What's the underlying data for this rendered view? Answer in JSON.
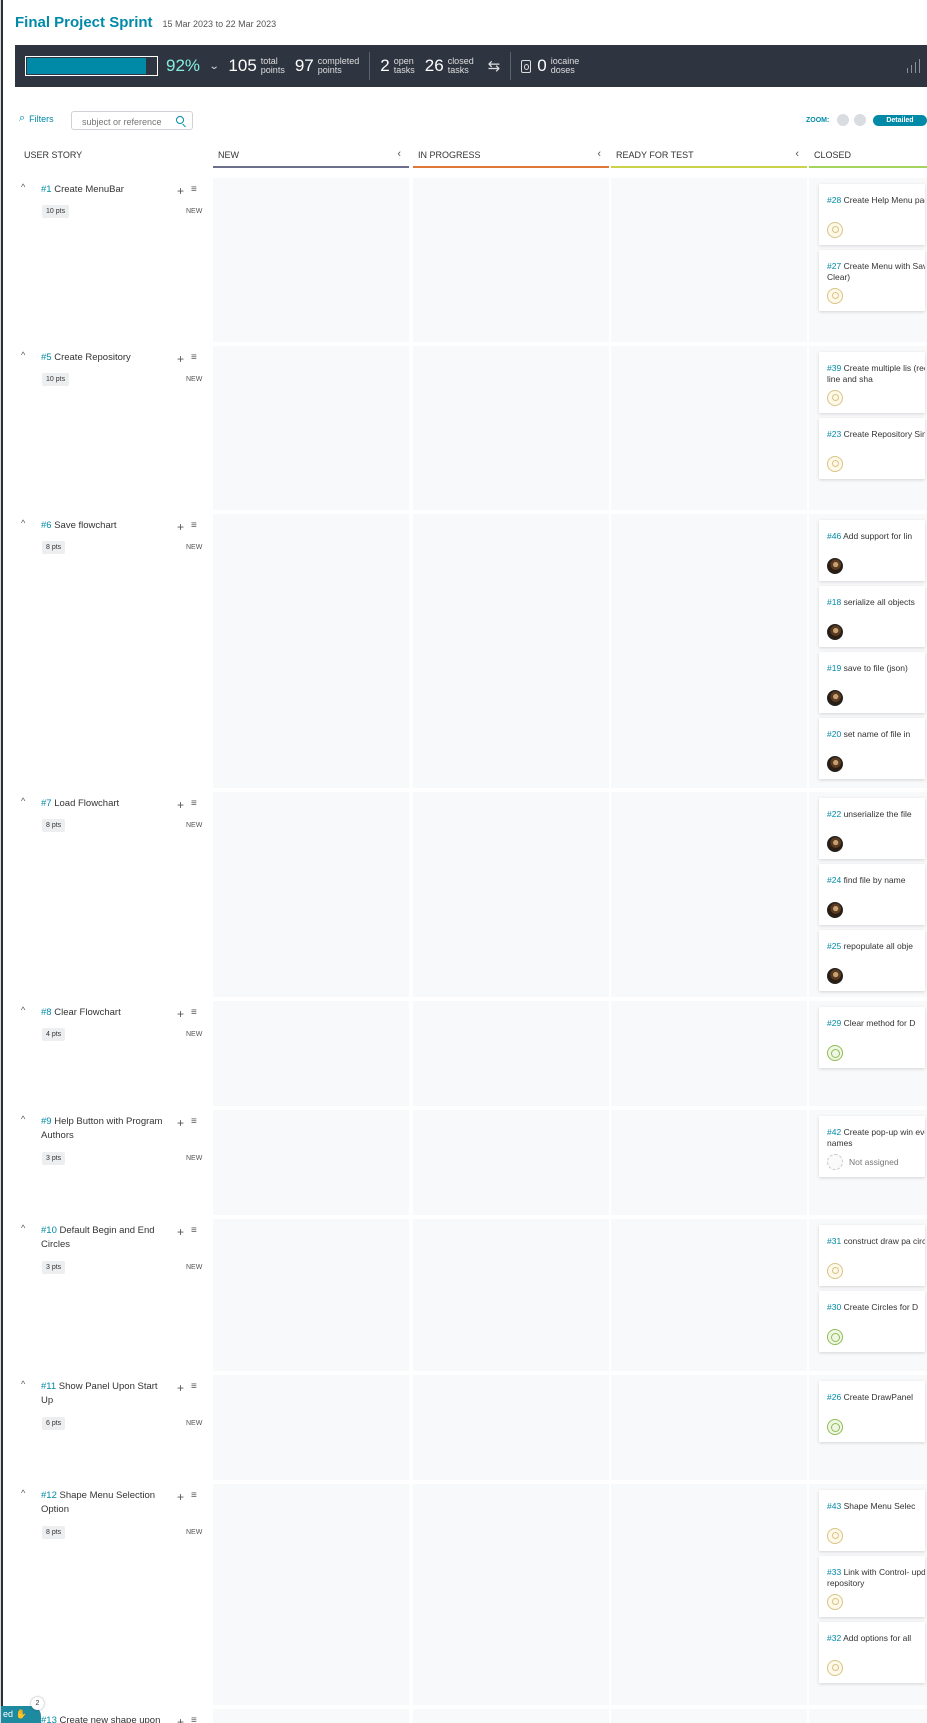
{
  "sprint": {
    "title": "Final Project Sprint",
    "dates": "15 Mar 2023 to 22 Mar 2023"
  },
  "stats": {
    "progress_fraction": 0.92,
    "percent": "92%",
    "total_points": "105",
    "total_points_label_1": "total",
    "total_points_label_2": "points",
    "completed_points": "97",
    "completed_points_label_1": "completed",
    "completed_points_label_2": "points",
    "open_tasks": "2",
    "open_tasks_label_1": "open",
    "open_tasks_label_2": "tasks",
    "closed_tasks": "26",
    "closed_tasks_label_1": "closed",
    "closed_tasks_label_2": "tasks",
    "iocaine": "0",
    "iocaine_label_1": "iocaine",
    "iocaine_label_2": "doses"
  },
  "toolbar": {
    "filters_label": "Filters",
    "search_placeholder": "subject or reference",
    "zoom_label": "ZOOM:",
    "zoom_selected": "Detailed"
  },
  "columns": {
    "user_story": "USER STORY",
    "lanes": [
      {
        "label": "NEW",
        "color": "#6c6f8a"
      },
      {
        "label": "IN PROGRESS",
        "color": "#e0773a"
      },
      {
        "label": "READY FOR TEST",
        "color": "#c9d34a"
      },
      {
        "label": "CLOSED",
        "color": "#a4d35e"
      }
    ]
  },
  "stories": [
    {
      "ref": "#1",
      "title": "Create MenuBar",
      "points": "10 pts",
      "status": "NEW",
      "tasks": [
        {
          "ref": "#28",
          "title": "Create Help Menu page",
          "avatar": "yellow"
        },
        {
          "ref": "#27",
          "title": "Create Menu with Save, Load, Clear)",
          "avatar": "yellow"
        }
      ]
    },
    {
      "ref": "#5",
      "title": "Create Repository",
      "points": "10 pts",
      "status": "NEW",
      "tasks": [
        {
          "ref": "#39",
          "title": "Create multiple lis (rectangle, line and sha",
          "avatar": "yellow"
        },
        {
          "ref": "#23",
          "title": "Create Repository Singleton",
          "avatar": "yellow"
        }
      ]
    },
    {
      "ref": "#6",
      "title": "Save flowchart",
      "points": "8 pts",
      "status": "NEW",
      "tasks": [
        {
          "ref": "#46",
          "title": "Add support for lin",
          "avatar": "photo"
        },
        {
          "ref": "#18",
          "title": "serialize all objects",
          "avatar": "photo"
        },
        {
          "ref": "#19",
          "title": "save to file (json)",
          "avatar": "photo"
        },
        {
          "ref": "#20",
          "title": "set name of file in",
          "avatar": "photo"
        }
      ]
    },
    {
      "ref": "#7",
      "title": "Load Flowchart",
      "points": "8 pts",
      "status": "NEW",
      "tasks": [
        {
          "ref": "#22",
          "title": "unserialize the file",
          "avatar": "photo"
        },
        {
          "ref": "#24",
          "title": "find file by name",
          "avatar": "photo"
        },
        {
          "ref": "#25",
          "title": "repopulate all obje",
          "avatar": "photo"
        }
      ]
    },
    {
      "ref": "#8",
      "title": "Clear Flowchart",
      "points": "4 pts",
      "status": "NEW",
      "tasks": [
        {
          "ref": "#29",
          "title": "Clear method for D",
          "avatar": "green"
        }
      ]
    },
    {
      "ref": "#9",
      "title": "Help Button with Program Authors",
      "points": "3 pts",
      "status": "NEW",
      "tasks": [
        {
          "ref": "#42",
          "title": "Create pop-up win everyone's names",
          "avatar": "empty",
          "assignee": "Not assigned"
        }
      ]
    },
    {
      "ref": "#10",
      "title": "Default Begin and End Circles",
      "points": "3 pts",
      "status": "NEW",
      "tasks": [
        {
          "ref": "#31",
          "title": "construct draw pa circles on it",
          "avatar": "yellow"
        },
        {
          "ref": "#30",
          "title": "Create Circles for D",
          "avatar": "green"
        }
      ]
    },
    {
      "ref": "#11",
      "title": "Show Panel Upon Start Up",
      "points": "6 pts",
      "status": "NEW",
      "tasks": [
        {
          "ref": "#26",
          "title": "Create DrawPanel",
          "avatar": "green"
        }
      ]
    },
    {
      "ref": "#12",
      "title": "Shape Menu Selection Option",
      "points": "8 pts",
      "status": "NEW",
      "tasks": [
        {
          "ref": "#43",
          "title": "Shape Menu Selec",
          "avatar": "yellow"
        },
        {
          "ref": "#33",
          "title": "Link with Control- update repository",
          "avatar": "yellow"
        },
        {
          "ref": "#32",
          "title": "Add options for all",
          "avatar": "yellow"
        }
      ]
    },
    {
      "ref": "#13",
      "title": "Create new shape upon",
      "points": "",
      "status": "",
      "tasks": []
    }
  ],
  "widget": {
    "label": "ed",
    "count": "2"
  }
}
